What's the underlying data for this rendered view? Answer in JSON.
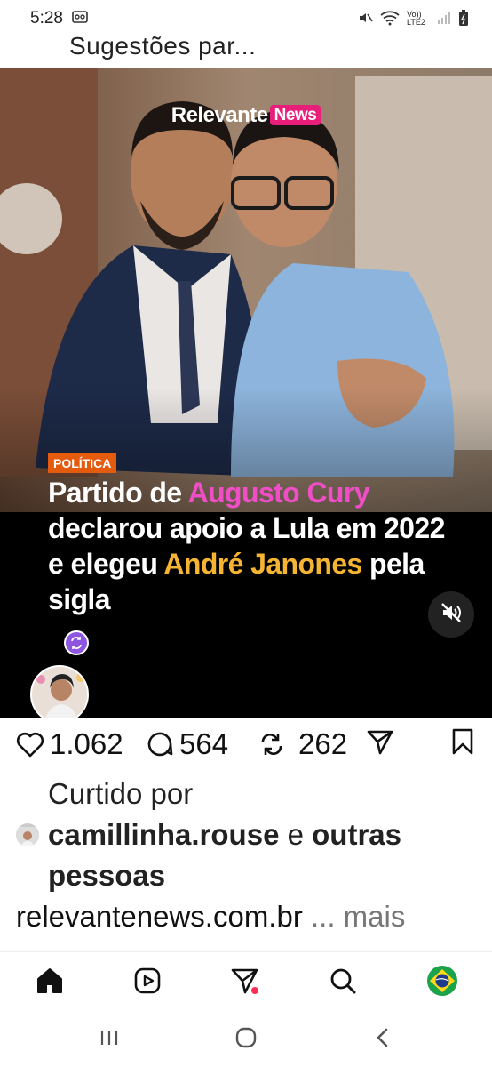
{
  "status_bar": {
    "time": "5:28",
    "network_label": "Vo)) LTE2"
  },
  "header": {
    "title": "Sugestões par..."
  },
  "post": {
    "brand": {
      "name": "Relevante",
      "badge": "News"
    },
    "category": "POLÍTICA",
    "headline": {
      "part1": "Partido de ",
      "highlight1": "Augusto Cury",
      "part2": " declarou apoio a Lula em 2022 e elegeu ",
      "highlight2": "André Janones",
      "part3": " pela sigla"
    },
    "colors": {
      "highlight1": "#f04ec7",
      "highlight2": "#f5b431",
      "category_bg": "#e45b0e"
    }
  },
  "actions": {
    "likes": "1.062",
    "comments": "564",
    "reposts": "262"
  },
  "liked_by": {
    "label": "Curtido por",
    "user": "camillinha.rouse",
    "connector": " e ",
    "others": "outras",
    "others2": "pessoas"
  },
  "caption": {
    "text": "relevantenews.com.br",
    "more": " ... mais"
  },
  "icons": {
    "like": "heart-icon",
    "comment": "comment-icon",
    "repost": "repost-icon",
    "share": "send-icon",
    "save": "bookmark-icon",
    "mute": "speaker-muted-icon",
    "home": "home-icon",
    "reels": "reels-icon",
    "direct": "direct-icon",
    "search": "search-icon",
    "profile": "profile-avatar"
  }
}
